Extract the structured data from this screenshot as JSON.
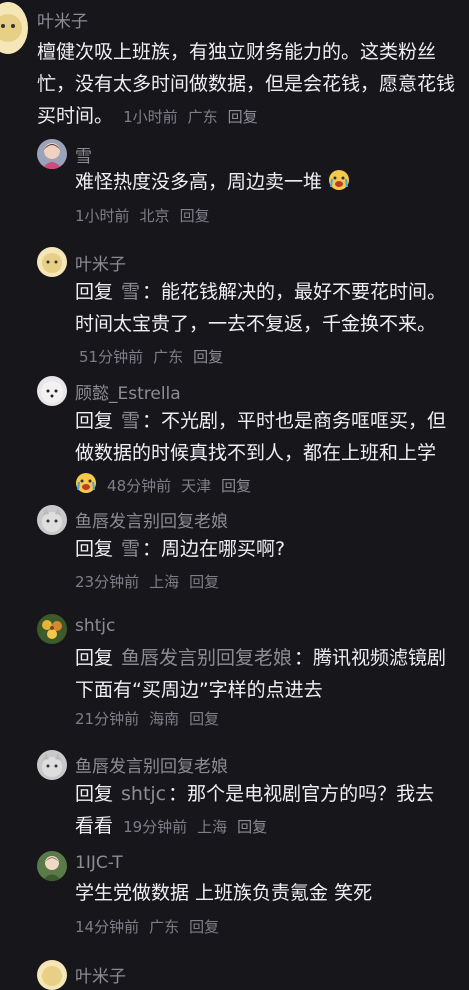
{
  "colors": {
    "background": "#17161b",
    "text": "#efeef3",
    "muted": "#7f7e88"
  },
  "comments": [
    {
      "name": "叶米子",
      "text": "檀健次吸上班族，有独立财务能力的。这类粉丝忙，没有太多时间做数据，但是会花钱，愿意花钱买时间。",
      "time": "1小时前",
      "location": "广东",
      "reply_label": "回复"
    },
    {
      "name": "雪",
      "text": "难怪热度没多高，周边卖一堆",
      "time": "1小时前",
      "location": "北京",
      "reply_label": "回复"
    },
    {
      "name": "叶米子",
      "reply_prefix": "回复",
      "reply_to": "雪",
      "text": "能花钱解决的，最好不要花时间。时间太宝贵了，一去不复返，千金换不来。",
      "time": "51分钟前",
      "location": "广东",
      "reply_label": "回复"
    },
    {
      "name": "顾懿_Estrella",
      "reply_prefix": "回复",
      "reply_to": "雪",
      "text": "不光剧，平时也是商务哐哐买，但做数据的时候真找不到人，都在上班和上学",
      "time": "48分钟前",
      "location": "天津",
      "reply_label": "回复"
    },
    {
      "name": "鱼唇发言别回复老娘",
      "reply_prefix": "回复",
      "reply_to": "雪",
      "text": "周边在哪买啊?",
      "time": "23分钟前",
      "location": "上海",
      "reply_label": "回复"
    },
    {
      "name": "shtjc",
      "reply_prefix": "回复",
      "reply_to": "鱼唇发言别回复老娘",
      "text": "腾讯视频滤镜剧下面有“买周边”字样的点进去",
      "time": "21分钟前",
      "location": "海南",
      "reply_label": "回复"
    },
    {
      "name": "鱼唇发言别回复老娘",
      "reply_prefix": "回复",
      "reply_to": "shtjc",
      "text": "那个是电视剧官方的吗？我去看看",
      "time": "19分钟前",
      "location": "上海",
      "reply_label": "回复"
    },
    {
      "name": "1IJC-T",
      "text": "学生党做数据 上班族负责氪金 笑死",
      "time": "14分钟前",
      "location": "广东",
      "reply_label": "回复"
    },
    {
      "name": "叶米子"
    }
  ]
}
